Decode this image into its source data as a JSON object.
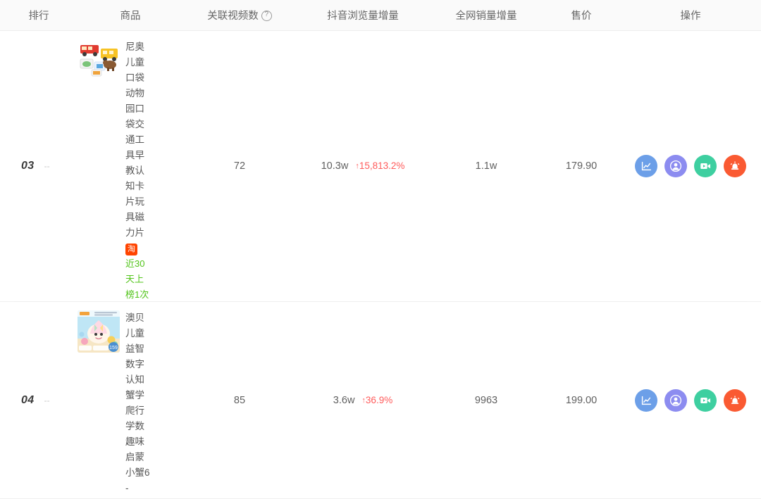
{
  "table": {
    "columns": [
      {
        "key": "rank",
        "label": "排行",
        "help": false
      },
      {
        "key": "prod",
        "label": "商品",
        "help": false
      },
      {
        "key": "video",
        "label": "关联视频数",
        "help": true
      },
      {
        "key": "views",
        "label": "抖音浏览量增量",
        "help": false
      },
      {
        "key": "sales",
        "label": "全网销量增量",
        "help": false
      },
      {
        "key": "price",
        "label": "售价",
        "help": false
      },
      {
        "key": "ops",
        "label": "操作",
        "help": false
      }
    ],
    "help_glyph": "?",
    "rows": [
      {
        "rank": "03",
        "rank_delta": "--",
        "title": "尼奥儿童口袋动物园口袋交通工具早教认知卡片玩具磁力片",
        "platform_badge": "淘",
        "onlist_text": "近30天上榜1次",
        "video_count": "72",
        "views": "10.3w",
        "views_change": "15,813.2%",
        "views_arrow": "↑",
        "sales": "1.1w",
        "price": "179.90"
      },
      {
        "rank": "04",
        "rank_delta": "--",
        "title": "澳贝儿童益智数字认知蟹学爬行学数趣味启蒙小蟹6-",
        "platform_badge": "",
        "onlist_text": "",
        "video_count": "85",
        "views": "3.6w",
        "views_change": "36.9%",
        "views_arrow": "↑",
        "sales": "9963",
        "price": "199.00"
      }
    ],
    "operations": [
      {
        "name": "trend-chart",
        "label": "趋势",
        "color": "#6c9fe8",
        "icon": "chart-line-icon"
      },
      {
        "name": "influencer",
        "label": "达人",
        "color": "#8c8cf0",
        "icon": "user-circle-icon"
      },
      {
        "name": "video",
        "label": "视频",
        "color": "#3ecfa0",
        "icon": "video-camera-icon"
      },
      {
        "name": "monitor",
        "label": "监控",
        "color": "#fa5a32",
        "icon": "alarm-siren-icon"
      }
    ]
  },
  "colors": {
    "header_bg": "#fafafa",
    "up_red": "#ff5b5b",
    "onlist_green": "#52c41a",
    "taobao_orange": "#ff4400"
  }
}
